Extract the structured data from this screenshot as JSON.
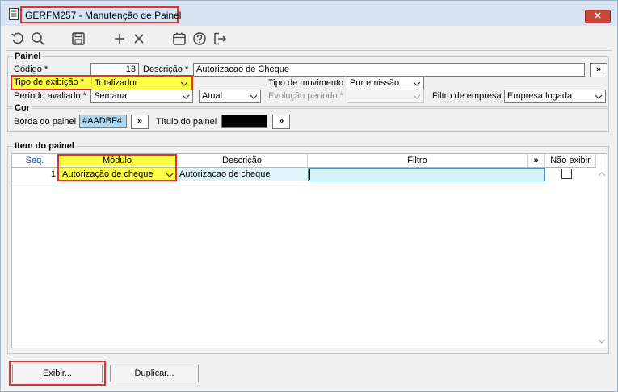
{
  "window": {
    "title": "GERFM257 - Manutenção de Painel",
    "close_label": "✕"
  },
  "toolbar": {
    "icons": [
      "undo-icon",
      "search-icon",
      "save-icon",
      "add-icon",
      "delete-icon",
      "calendar-icon",
      "help-icon",
      "exit-icon"
    ]
  },
  "painel": {
    "group_title": "Painel",
    "codigo_label": "Código *",
    "codigo_value": "13",
    "descricao_label": "Descrição *",
    "descricao_value": "Autorizacao de Cheque",
    "descricao_btn": "»",
    "tipo_exibicao_label": "Tipo de exibição *",
    "tipo_exibicao_value": "Totalizador",
    "tipo_movimento_label": "Tipo de movimento",
    "tipo_movimento_value": "Por emissão",
    "periodo_label": "Período avaliado *",
    "periodo_value": "Semana",
    "periodo_value2": "Atual",
    "evolucao_label": "Evolução período *",
    "evolucao_value": "",
    "filtro_empresa_label": "Filtro de empresa",
    "filtro_empresa_value": "Empresa logada"
  },
  "cor": {
    "group_title": "Cor",
    "borda_label": "Borda do painel",
    "borda_value": "#AADBF4",
    "borda_btn": "»",
    "titulo_label": "Título do painel",
    "titulo_btn": "»",
    "titulo_color": "#000000"
  },
  "itens": {
    "group_title": "Item do painel",
    "columns": {
      "seq": "Seq.",
      "modulo": "Módulo",
      "descricao": "Descrição",
      "filtro": "Filtro",
      "filtro_btn": "»",
      "nao_exibir": "Não exibir"
    },
    "rows": [
      {
        "seq": "1",
        "modulo": "Autorização de cheque",
        "descricao": "Autorizacao de cheque",
        "filtro": "",
        "nao_exibir": false
      }
    ]
  },
  "buttons": {
    "exibir": "Exibir...",
    "duplicar": "Duplicar..."
  },
  "colors": {
    "highlight_red": "#e03030",
    "highlight_yellow": "#ffff44",
    "border_color": "#aadbf4"
  }
}
